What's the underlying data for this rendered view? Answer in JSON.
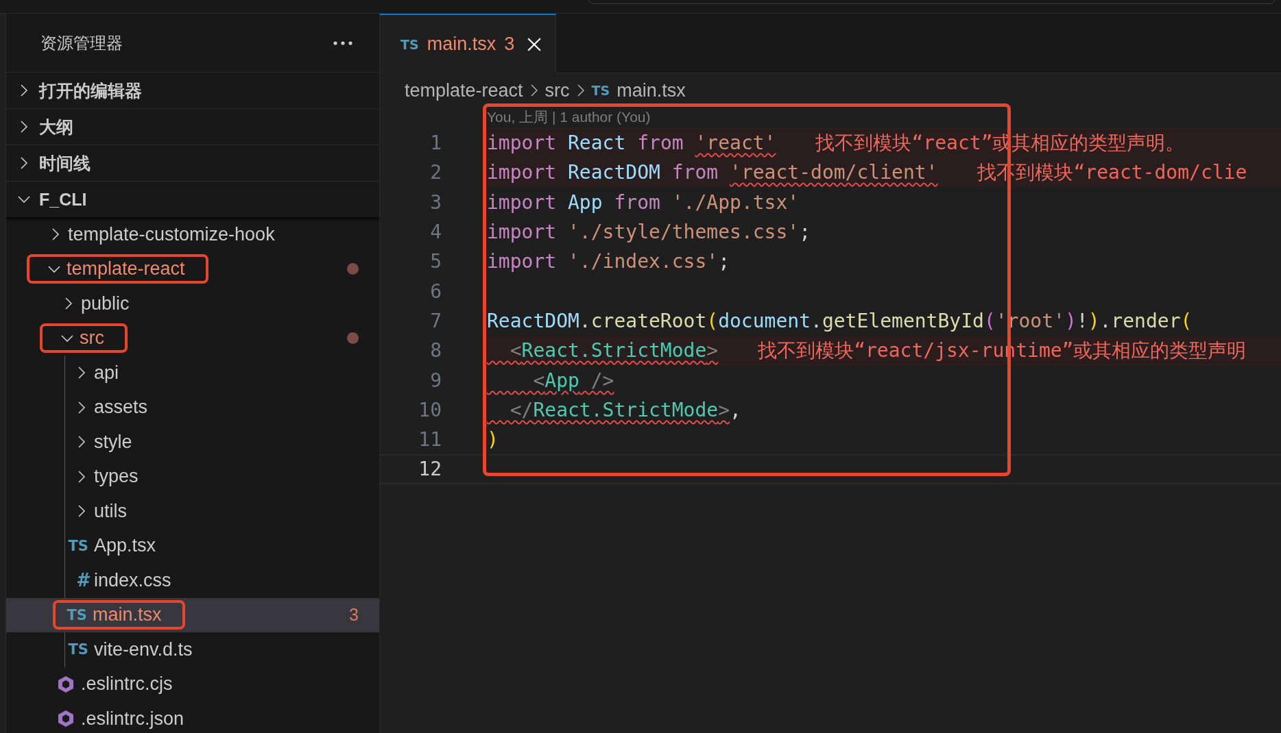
{
  "sidebar": {
    "title": "资源管理器",
    "sections": [
      {
        "label": "打开的编辑器",
        "expanded": false
      },
      {
        "label": "大纲",
        "expanded": false
      },
      {
        "label": "时间线",
        "expanded": false
      },
      {
        "label": "F_CLI",
        "expanded": true,
        "children": [
          {
            "label": "template-customize-hook",
            "kind": "folder",
            "expanded": false,
            "selected": false,
            "error": false,
            "dot": false,
            "annotated": false
          },
          {
            "label": "template-react",
            "kind": "folder",
            "expanded": true,
            "selected": false,
            "error": true,
            "dot": true,
            "annotated": true,
            "children": [
              {
                "label": "public",
                "kind": "folder",
                "expanded": false,
                "selected": false,
                "error": false,
                "dot": false,
                "annotated": false
              },
              {
                "label": "src",
                "kind": "folder",
                "expanded": true,
                "selected": false,
                "error": true,
                "dot": true,
                "annotated": true,
                "children": [
                  {
                    "label": "api",
                    "kind": "folder",
                    "expanded": false,
                    "selected": false,
                    "error": false,
                    "dot": false,
                    "annotated": false
                  },
                  {
                    "label": "assets",
                    "kind": "folder",
                    "expanded": false,
                    "selected": false,
                    "error": false,
                    "dot": false,
                    "annotated": false
                  },
                  {
                    "label": "style",
                    "kind": "folder",
                    "expanded": false,
                    "selected": false,
                    "error": false,
                    "dot": false,
                    "annotated": false
                  },
                  {
                    "label": "types",
                    "kind": "folder",
                    "expanded": false,
                    "selected": false,
                    "error": false,
                    "dot": false,
                    "annotated": false
                  },
                  {
                    "label": "utils",
                    "kind": "folder",
                    "expanded": false,
                    "selected": false,
                    "error": false,
                    "dot": false,
                    "annotated": false
                  },
                  {
                    "label": "App.tsx",
                    "kind": "ts",
                    "icon_text": "TS",
                    "selected": false,
                    "error": false,
                    "dot": false,
                    "annotated": false
                  },
                  {
                    "label": "index.css",
                    "kind": "css",
                    "icon_text": "#",
                    "selected": false,
                    "error": false,
                    "dot": false,
                    "annotated": false
                  },
                  {
                    "label": "main.tsx",
                    "kind": "ts",
                    "icon_text": "TS",
                    "selected": true,
                    "error": true,
                    "dot": false,
                    "badge": "3",
                    "annotated": true
                  },
                  {
                    "label": "vite-env.d.ts",
                    "kind": "ts",
                    "icon_text": "TS",
                    "selected": false,
                    "error": false,
                    "dot": false,
                    "annotated": false
                  }
                ]
              },
              {
                "label": ".eslintrc.cjs",
                "kind": "eslint",
                "selected": false,
                "error": false,
                "dot": false,
                "annotated": false
              },
              {
                "label": ".eslintrc.json",
                "kind": "eslint",
                "selected": false,
                "error": false,
                "dot": false,
                "annotated": false
              }
            ]
          }
        ]
      }
    ]
  },
  "tabs": [
    {
      "icon_text": "TS",
      "label": "main.tsx",
      "badge": "3",
      "selected": true,
      "error": true
    }
  ],
  "breadcrumb": [
    {
      "label": "template-react"
    },
    {
      "label": "src"
    },
    {
      "label": "main.tsx",
      "icon_text": "TS"
    }
  ],
  "blame": "You, 上周 | 1 author (You)",
  "code": {
    "annotated": true,
    "lines": [
      {
        "number": "1",
        "current": false,
        "error": "找不到模块“react”或其相应的类型声明。",
        "tokens": [
          {
            "text": "import ",
            "kind": "keyword"
          },
          {
            "text": "React ",
            "kind": "variable"
          },
          {
            "text": "from ",
            "kind": "keyword"
          },
          {
            "text": "'react'",
            "kind": "string",
            "squiggle": true
          }
        ]
      },
      {
        "number": "2",
        "current": false,
        "error": "找不到模块“react-dom/clie",
        "tokens": [
          {
            "text": "import ",
            "kind": "keyword"
          },
          {
            "text": "ReactDOM ",
            "kind": "variable"
          },
          {
            "text": "from ",
            "kind": "keyword"
          },
          {
            "text": "'react-dom/client'",
            "kind": "string",
            "squiggle": true
          }
        ]
      },
      {
        "number": "3",
        "current": false,
        "tokens": [
          {
            "text": "import ",
            "kind": "keyword"
          },
          {
            "text": "App ",
            "kind": "variable"
          },
          {
            "text": "from ",
            "kind": "keyword"
          },
          {
            "text": "'./App.tsx'",
            "kind": "string"
          }
        ]
      },
      {
        "number": "4",
        "current": false,
        "tokens": [
          {
            "text": "import ",
            "kind": "keyword"
          },
          {
            "text": "'./style/themes.css'",
            "kind": "string"
          },
          {
            "text": ";",
            "kind": "plain"
          }
        ]
      },
      {
        "number": "5",
        "current": false,
        "tokens": [
          {
            "text": "import ",
            "kind": "keyword"
          },
          {
            "text": "'./index.css'",
            "kind": "string"
          },
          {
            "text": ";",
            "kind": "plain"
          }
        ]
      },
      {
        "number": "6",
        "current": false
      },
      {
        "number": "7",
        "current": false,
        "tokens": [
          {
            "text": "ReactDOM",
            "kind": "variable"
          },
          {
            "text": ".",
            "kind": "plain"
          },
          {
            "text": "createRoot",
            "kind": "function"
          },
          {
            "text": "(",
            "kind": "bracket-gold"
          },
          {
            "text": "document",
            "kind": "variable"
          },
          {
            "text": ".",
            "kind": "plain"
          },
          {
            "text": "getElementById",
            "kind": "function"
          },
          {
            "text": "(",
            "kind": "bracket-purple"
          },
          {
            "text": "'root'",
            "kind": "string"
          },
          {
            "text": ")",
            "kind": "bracket-purple"
          },
          {
            "text": "!",
            "kind": "plain"
          },
          {
            "text": ")",
            "kind": "bracket-gold"
          },
          {
            "text": ".",
            "kind": "plain"
          },
          {
            "text": "render",
            "kind": "function"
          },
          {
            "text": "(",
            "kind": "bracket-gold"
          }
        ]
      },
      {
        "number": "8",
        "current": false,
        "error": "找不到模块“react/jsx-runtime”或其相应的类型声明",
        "tokens": [
          {
            "text": "  <",
            "kind": "punct",
            "squiggle": true
          },
          {
            "text": "React.StrictMode",
            "kind": "tag",
            "squiggle": true
          },
          {
            "text": ">",
            "kind": "punct",
            "squiggle": true
          }
        ]
      },
      {
        "number": "9",
        "current": false,
        "tokens": [
          {
            "text": "    <",
            "kind": "punct",
            "squiggle": true
          },
          {
            "text": "App",
            "kind": "tag",
            "squiggle": true
          },
          {
            "text": " />",
            "kind": "punct",
            "squiggle": true
          }
        ]
      },
      {
        "number": "10",
        "current": false,
        "tokens": [
          {
            "text": "  </",
            "kind": "punct",
            "squiggle": true
          },
          {
            "text": "React.StrictMode",
            "kind": "tag",
            "squiggle": true
          },
          {
            "text": ">",
            "kind": "punct",
            "squiggle": true
          },
          {
            "text": ",",
            "kind": "plain"
          }
        ]
      },
      {
        "number": "11",
        "current": false,
        "tokens": [
          {
            "text": ")",
            "kind": "bracket-gold"
          }
        ]
      },
      {
        "number": "12",
        "current": true
      }
    ]
  }
}
